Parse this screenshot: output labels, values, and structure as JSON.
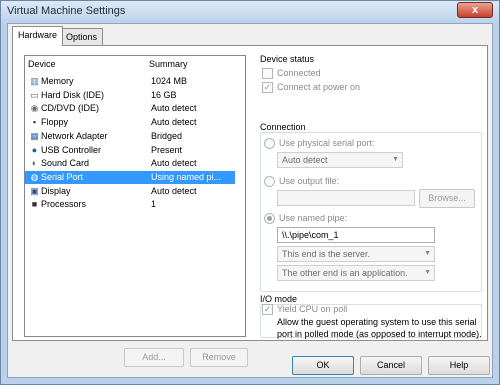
{
  "window": {
    "title": "Virtual Machine Settings",
    "close_glyph": "x"
  },
  "tabs": [
    {
      "label": "Hardware",
      "active": true
    },
    {
      "label": "Options",
      "active": false
    }
  ],
  "device_list": {
    "col_device": "Device",
    "col_summary": "Summary",
    "rows": [
      {
        "name": "Memory",
        "summary": "1024 MB",
        "icon": "memory-icon",
        "glyph": "▥",
        "color": "#4a6fa5"
      },
      {
        "name": "Hard Disk (IDE)",
        "summary": "16 GB",
        "icon": "hard-disk-icon",
        "glyph": "▭",
        "color": "#555555"
      },
      {
        "name": "CD/DVD (IDE)",
        "summary": "Auto detect",
        "icon": "cd-dvd-icon",
        "glyph": "◉",
        "color": "#6b6b6b"
      },
      {
        "name": "Floppy",
        "summary": "Auto detect",
        "icon": "floppy-icon",
        "glyph": "▪",
        "color": "#3b3b3b"
      },
      {
        "name": "Network Adapter",
        "summary": "Bridged",
        "icon": "network-adapter-icon",
        "glyph": "▦",
        "color": "#2f6db5"
      },
      {
        "name": "USB Controller",
        "summary": "Present",
        "icon": "usb-icon",
        "glyph": "●",
        "color": "#1f5fa8"
      },
      {
        "name": "Sound Card",
        "summary": "Auto detect",
        "icon": "sound-card-icon",
        "glyph": "◐",
        "color": "#555555"
      },
      {
        "name": "Serial Port",
        "summary": "Using named pi...",
        "icon": "serial-port-icon",
        "glyph": "◍",
        "color": "#2f6db5",
        "selected": true
      },
      {
        "name": "Display",
        "summary": "Auto detect",
        "icon": "display-icon",
        "glyph": "▣",
        "color": "#2c4f85"
      },
      {
        "name": "Processors",
        "summary": "1",
        "icon": "processors-icon",
        "glyph": "■",
        "color": "#333333"
      }
    ]
  },
  "device_buttons": {
    "add": "Add...",
    "remove": "Remove"
  },
  "device_status": {
    "title": "Device status",
    "connected": "Connected",
    "connect_power_on": "Connect at power on"
  },
  "connection": {
    "title": "Connection",
    "physical_port": "Use physical serial port:",
    "physical_port_value": "Auto detect",
    "output_file": "Use output file:",
    "output_file_value": "",
    "browse": "Browse...",
    "named_pipe": "Use named pipe:",
    "pipe_name": "\\\\.\\pipe\\com_1",
    "end_role": "This end is the server.",
    "other_end": "The other end is an application."
  },
  "io_mode": {
    "title": "I/O mode",
    "yield_cpu": "Yield CPU on poll",
    "description": "Allow the guest operating system to use this serial port in polled mode (as opposed to interrupt mode)."
  },
  "footer": {
    "ok": "OK",
    "cancel": "Cancel",
    "help": "Help"
  }
}
